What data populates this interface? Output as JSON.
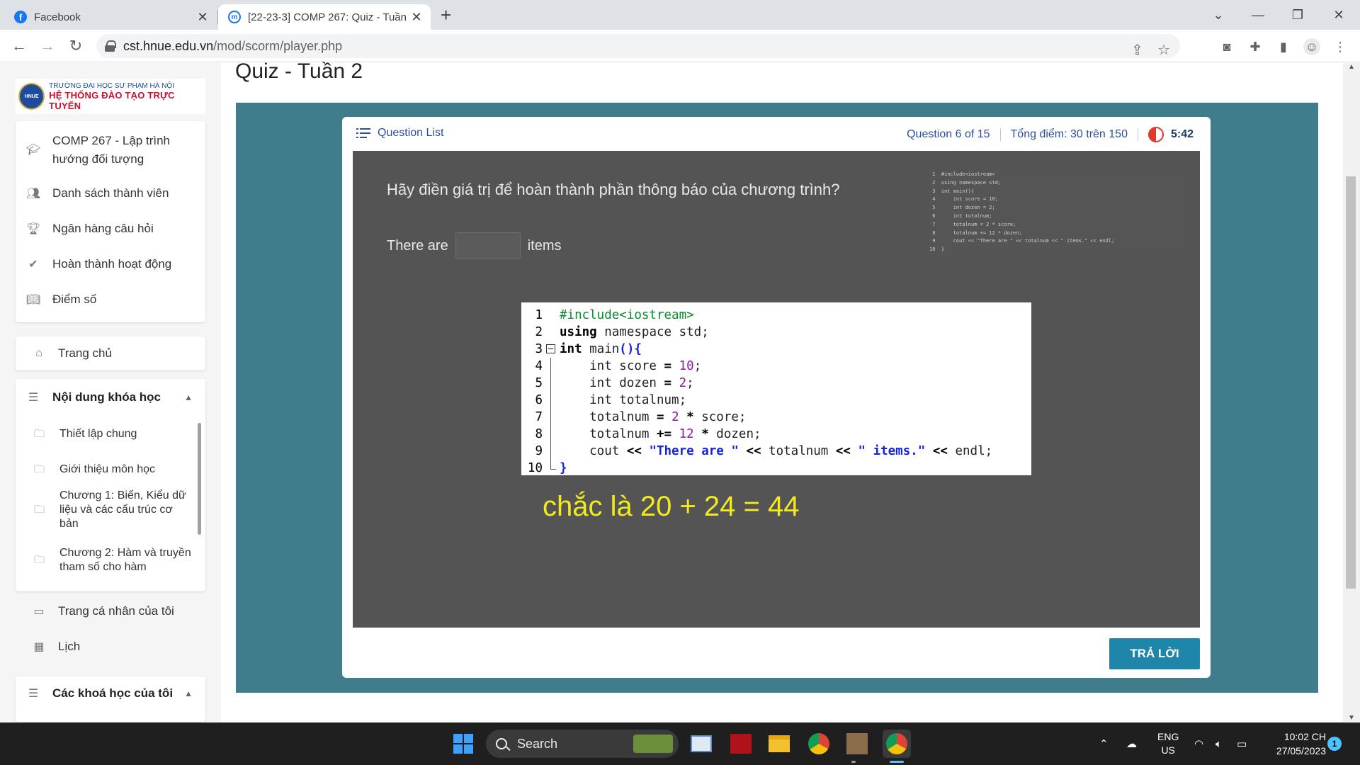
{
  "browser": {
    "tabs": [
      {
        "title": "Facebook"
      },
      {
        "title": "[22-23-3] COMP 267: Quiz - Tuần 2"
      }
    ],
    "url_host": "cst.hnue.edu.vn",
    "url_path": "/mod/scorm/player.php"
  },
  "brand": {
    "line1": "TRƯỜNG ĐẠI HỌC SƯ PHẠM HÀ NỘI",
    "line2": "HỆ THỐNG ĐÀO TẠO TRỰC TUYẾN",
    "seal": "HNUE"
  },
  "sidebar": {
    "course_items": [
      "COMP 267 - Lập trình hướng đối tượng",
      "Danh sách thành viên",
      "Ngân hàng câu hỏi",
      "Hoàn thành hoạt động",
      "Điểm số"
    ],
    "home": "Trang chủ",
    "course_content_header": "Nội dung khóa học",
    "course_content_items": [
      "Thiết lập chung",
      "Giới thiệu môn học",
      "Chương 1: Biến, Kiểu dữ liệu và các cấu trúc cơ bản",
      "Chương 2: Hàm và truyền tham số cho hàm"
    ],
    "profile": "Trang cá nhân của tôi",
    "calendar": "Lịch",
    "my_courses": "Các khoá học của tôi"
  },
  "page": {
    "title": "Quiz - Tuần 2"
  },
  "quiz": {
    "question_list_label": "Question List",
    "question_counter": "Question 6 of 15",
    "score": "Tổng điểm: 30 trên 150",
    "timer": "5:42",
    "question_text": "Hãy điền giá trị để hoàn thành phần thông báo của chương trình?",
    "fill_before": "There are",
    "fill_value": "",
    "fill_after": "items",
    "code_lines": [
      "#include<iostream>",
      "using namespace std;",
      "int main(){",
      "    int score = 10;",
      "    int dozen = 2;",
      "    int totalnum;",
      "    totalnum = 2 * score;",
      "    totalnum += 12 * dozen;",
      "    cout << \"There are \" << totalnum << \" items.\" << endl;",
      "}"
    ],
    "annotation": "chắc là 20 + 24 = 44",
    "answer_button": "TRẢ LỜI"
  },
  "taskbar": {
    "search_label": "Search",
    "lang_line1": "ENG",
    "lang_line2": "US",
    "time": "10:02 CH",
    "date": "27/05/2023",
    "notification_count": "1"
  },
  "colors": {
    "stage_bg": "#407d8c",
    "question_bg": "#545454",
    "answer_button": "#1f86a9",
    "annotation": "#f2ea1e",
    "link_blue": "#2b4f9e"
  }
}
